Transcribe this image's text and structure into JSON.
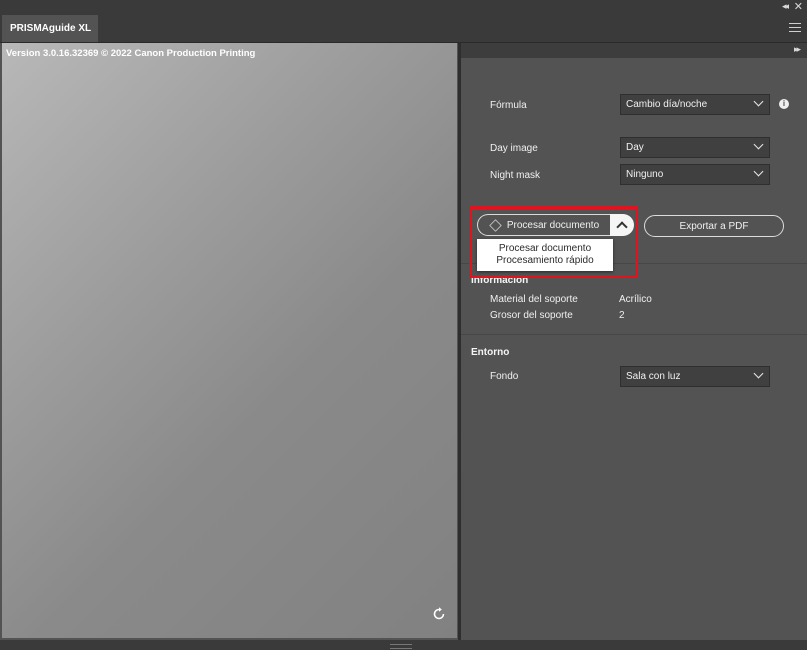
{
  "window": {
    "tab_title": "PRISMAguide XL",
    "collapse_glyph": "◂◂",
    "close_glyph": "✕",
    "expand_glyph": "▸▸"
  },
  "preview": {
    "version_text": "Version 3.0.16.32369 © 2022 Canon Production Printing"
  },
  "settings": {
    "formula_label": "Fórmula",
    "formula_value": "Cambio día/noche",
    "day_image_label": "Day image",
    "day_image_value": "Day",
    "night_mask_label": "Night mask",
    "night_mask_value": "Ninguno"
  },
  "actions": {
    "process_label": "Procesar documento",
    "export_label": "Exportar a PDF",
    "menu_items": [
      "Procesar documento",
      "Procesamiento rápido"
    ]
  },
  "information": {
    "title": "Información",
    "rows": [
      {
        "label": "Material del soporte",
        "value": "Acrílico"
      },
      {
        "label": "Grosor del soporte",
        "value": "2"
      }
    ]
  },
  "environment": {
    "title": "Entorno",
    "background_label": "Fondo",
    "background_value": "Sala con luz"
  },
  "colors": {
    "highlight": "#e0141e",
    "panel_bg": "#535353",
    "dark_bar": "#3a3a3a"
  }
}
